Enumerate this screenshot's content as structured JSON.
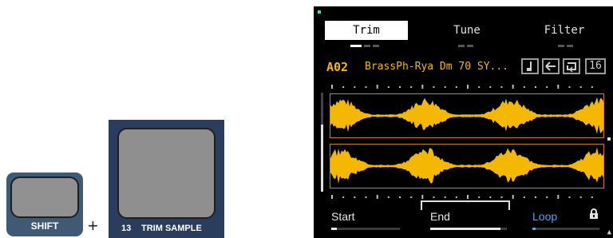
{
  "hardware": {
    "shift_button": {
      "label": "SHIFT"
    },
    "plus": "+",
    "trim_sample_button": {
      "number": "13",
      "label": "TRIM SAMPLE"
    }
  },
  "screen": {
    "tabs": [
      {
        "label": "Trim",
        "active": true
      },
      {
        "label": "Tune",
        "active": false
      },
      {
        "label": "Filter",
        "active": false
      }
    ],
    "sample": {
      "slot": "A02",
      "name": "BrassPh-Rya Dm 70 SY..."
    },
    "toolbar_icons": [
      "note-icon",
      "back-arrow-icon",
      "loop-icon"
    ],
    "slice_count": "16",
    "params": {
      "start": {
        "label": "Start",
        "fraction": 0.08
      },
      "end": {
        "label": "End",
        "fraction": 0.92
      },
      "loop": {
        "label": "Loop",
        "fraction": 0.05
      }
    },
    "colors": {
      "waveform": "#f5b800",
      "accent": "#42a8ff",
      "indicator": "#2ee6a8"
    }
  }
}
